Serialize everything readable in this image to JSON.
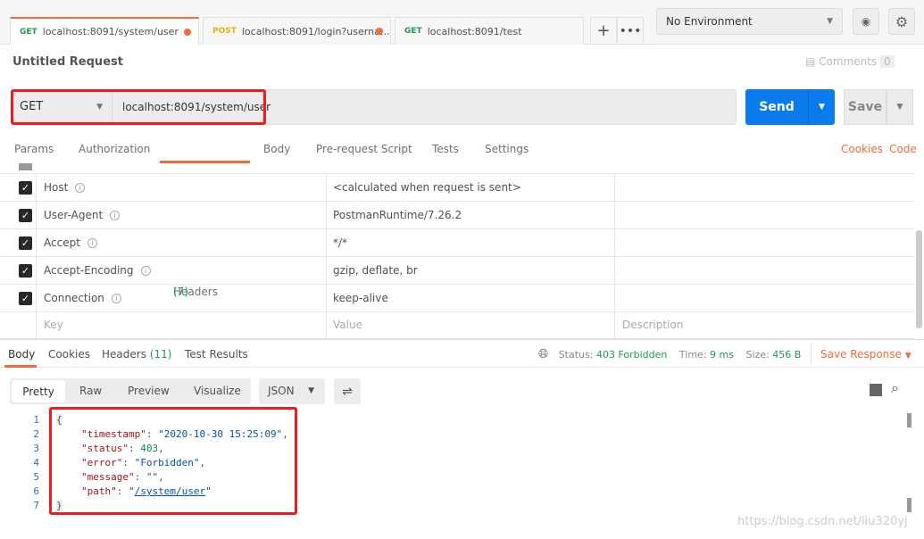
{
  "tabs": [
    {
      "method": "GET",
      "url": "localhost:8091/system/user",
      "unsaved": true
    },
    {
      "method": "POST",
      "url": "localhost:8091/login?userna…",
      "unsaved": true
    },
    {
      "method": "GET",
      "url": "localhost:8091/test",
      "unsaved": false
    }
  ],
  "environment": "No Environment",
  "request_title": "Untitled Request",
  "comments": {
    "label": "Comments",
    "count": "0"
  },
  "request": {
    "method": "GET",
    "url": "localhost:8091/system/user",
    "send": "Send",
    "save": "Save"
  },
  "request_tabs": {
    "params": "Params",
    "authorization": "Authorization",
    "headers": "Headers",
    "headers_count": "(7)",
    "body": "Body",
    "prerequest": "Pre-request Script",
    "tests": "Tests",
    "settings": "Settings",
    "cookies": "Cookies",
    "code": "Code"
  },
  "headers": [
    {
      "key": "Host",
      "value": "<calculated when request is sent>"
    },
    {
      "key": "User-Agent",
      "value": "PostmanRuntime/7.26.2"
    },
    {
      "key": "Accept",
      "value": "*/*"
    },
    {
      "key": "Accept-Encoding",
      "value": "gzip, deflate, br"
    },
    {
      "key": "Connection",
      "value": "keep-alive"
    }
  ],
  "headers_placeholder": {
    "key": "Key",
    "value": "Value",
    "description": "Description"
  },
  "response_tabs": {
    "body": "Body",
    "cookies": "Cookies",
    "headers": "Headers",
    "headers_count": "(11)",
    "test_results": "Test Results"
  },
  "status": {
    "status_label": "Status:",
    "status": "403 Forbidden",
    "time_label": "Time:",
    "time": "9 ms",
    "size_label": "Size:",
    "size": "456 B",
    "save_response": "Save Response"
  },
  "view": {
    "pretty": "Pretty",
    "raw": "Raw",
    "preview": "Preview",
    "visualize": "Visualize",
    "format": "JSON"
  },
  "body_lines": {
    "l1": "{",
    "k2": "\"timestamp\"",
    "v2": "\"2020-10-30 15:25:09\"",
    "k3": "\"status\"",
    "v3": "403",
    "k4": "\"error\"",
    "v4": "\"Forbidden\"",
    "k5": "\"message\"",
    "v5": "\"\"",
    "k6": "\"path\"",
    "v6": "/system/user",
    "l7": "}"
  },
  "watermark": "https://blog.csdn.net/liu320yj",
  "colors": {
    "accent": "#f26b3a",
    "send": "#097bed",
    "success": "#1d9c4f",
    "highlight": "#ff0000"
  }
}
